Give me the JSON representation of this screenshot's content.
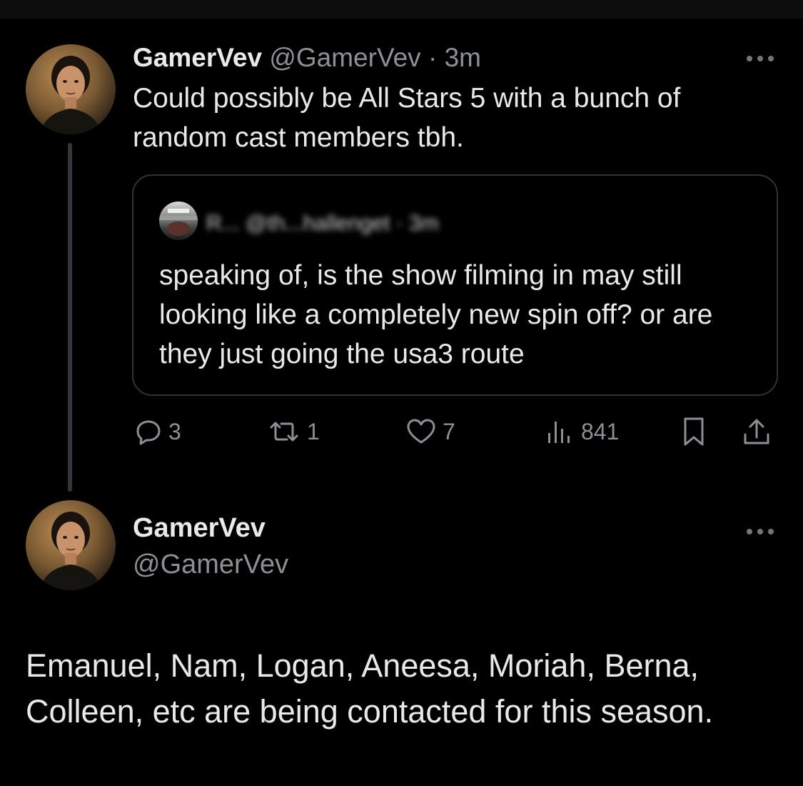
{
  "tweet1": {
    "display_name": "GamerVev",
    "handle": "@GamerVev",
    "separator": "·",
    "time": "3m",
    "text": "Could possibly be All Stars 5 with a bunch of random cast members tbh.",
    "more_icon": "ellipsis-icon"
  },
  "quote": {
    "header_obscured": "R... @th...hallenget · 3m",
    "text": "speaking of, is the show filming in may still looking like a completely new spin off? or are they just going the usa3 route"
  },
  "actions": {
    "replies": "3",
    "reposts": "1",
    "likes": "7",
    "views": "841"
  },
  "tweet2": {
    "display_name": "GamerVev",
    "handle": "@GamerVev",
    "text": "Emanuel, Nam, Logan, Aneesa, Moriah, Berna, Colleen, etc are being contacted for this season.",
    "more_icon": "ellipsis-icon"
  },
  "colors": {
    "background": "#000000",
    "text": "#e7e9ea",
    "muted": "#71767b",
    "border": "#2f3336"
  }
}
